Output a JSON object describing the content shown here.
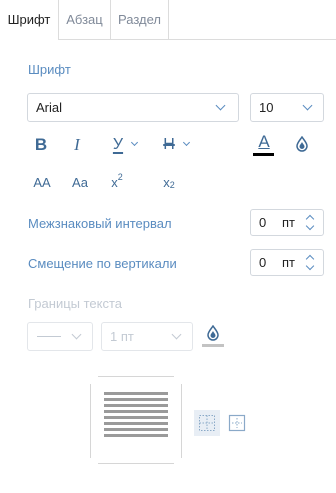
{
  "tabs": [
    {
      "label": "Шрифт"
    },
    {
      "label": "Абзац"
    },
    {
      "label": "Раздел"
    }
  ],
  "font_section": {
    "title": "Шрифт",
    "font_family": "Arial",
    "font_size": "10"
  },
  "format_buttons": {
    "bold": "B",
    "italic": "I",
    "underline": "У",
    "strike": "Н",
    "font_color": "A",
    "all_caps": "AA",
    "small_caps": "Aa",
    "superscript_base": "x",
    "superscript_mark": "2",
    "subscript_base": "x",
    "subscript_mark": "2"
  },
  "icons": {
    "highlight": "droplet-icon",
    "border_color": "droplet-icon",
    "dropdown": "chevron-down-icon",
    "spinner_up": "chevron-up-icon",
    "spinner_down": "chevron-down-icon"
  },
  "spacing": {
    "label": "Межзнаковый интервал",
    "value": "0",
    "unit": "пт"
  },
  "vertical_offset": {
    "label": "Смещение по вертикали",
    "value": "0",
    "unit": "пт"
  },
  "borders": {
    "title": "Границы текста",
    "width_value": "1 пт"
  },
  "colors": {
    "accent": "#5a8cc0",
    "font_color_bar": "#000000",
    "border_color_bar": "#c3c3c3"
  }
}
